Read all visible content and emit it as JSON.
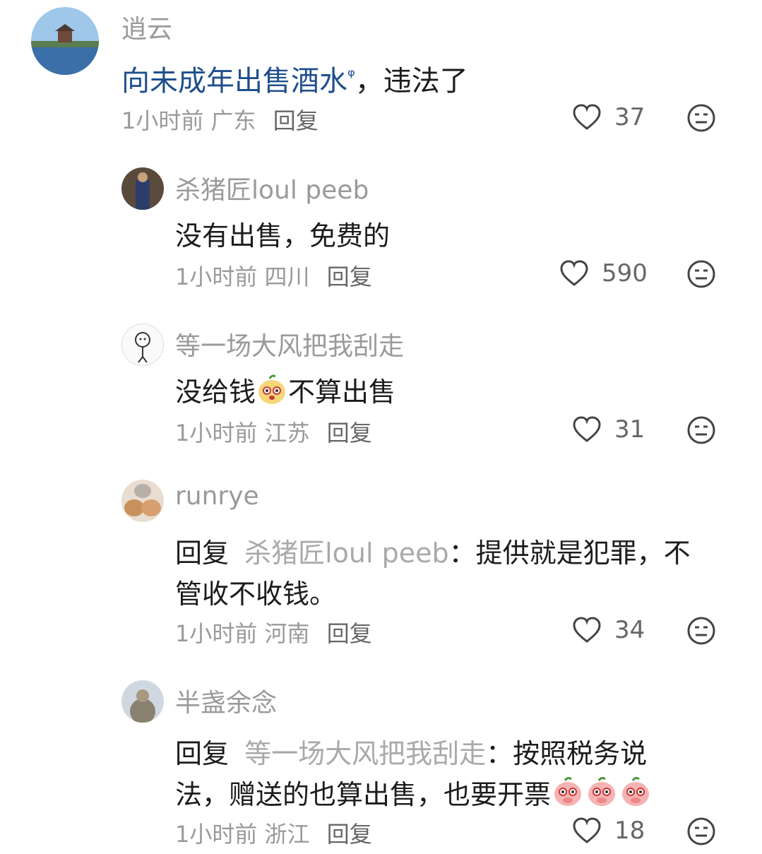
{
  "comments": [
    {
      "username": "逍云",
      "text_parts": [
        "向未成年出售酒水",
        "，违法了"
      ],
      "search_marker": "ᵠ",
      "time": "1小时前",
      "location": "广东",
      "reply_label": "回复",
      "likes": "37"
    },
    {
      "username": "杀猪匠loul peeb",
      "text": "没有出售，免费的",
      "time": "1小时前",
      "location": "四川",
      "reply_label": "回复",
      "likes": "590"
    },
    {
      "username": "等一场大风把我刮走",
      "text_before_emoji": "没给钱",
      "text_after_emoji": "不算出售",
      "time": "1小时前",
      "location": "江苏",
      "reply_label": "回复",
      "likes": "31"
    },
    {
      "username": "runrye",
      "reply_prefix": "回复",
      "reply_to": "杀猪匠loul peeb",
      "line1_rest": "：提供就是犯罪，不",
      "line2": "管收不收钱。",
      "time": "1小时前",
      "location": "河南",
      "reply_label": "回复",
      "likes": "34"
    },
    {
      "username": "半盏余念",
      "reply_prefix": "回复",
      "reply_to": "等一场大风把我刮走",
      "line1_rest": "：按照税务说",
      "line2": "法，赠送的也算出售，也要开票",
      "time": "1小时前",
      "location": "浙江",
      "reply_label": "回复",
      "likes": "18"
    }
  ],
  "colors": {
    "link_blue": "#1f4f8c",
    "meta_gray": "#9a9a9a",
    "text": "#1c1c1c"
  },
  "icons": {
    "like": "heart-outline-icon",
    "dislike": "neutral-face-icon"
  }
}
